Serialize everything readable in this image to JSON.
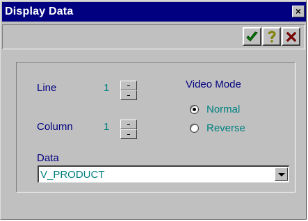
{
  "window": {
    "title": "Display Data",
    "close_label": "×"
  },
  "toolbar": {
    "ok_icon": "checkmark-icon",
    "help_icon": "question-icon",
    "cancel_icon": "x-icon"
  },
  "form": {
    "line_label": "Line",
    "line_value": "1",
    "column_label": "Column",
    "column_value": "1",
    "video_mode_label": "Video Mode",
    "video_modes": [
      {
        "label": "Normal",
        "selected": true
      },
      {
        "label": "Reverse",
        "selected": false
      }
    ],
    "data_label": "Data",
    "data_value": "V_PRODUCT"
  },
  "colors": {
    "titlebar": "#000080",
    "label": "#000080",
    "value": "#008080",
    "ok": "#008000",
    "help": "#808000",
    "cancel": "#800000"
  }
}
